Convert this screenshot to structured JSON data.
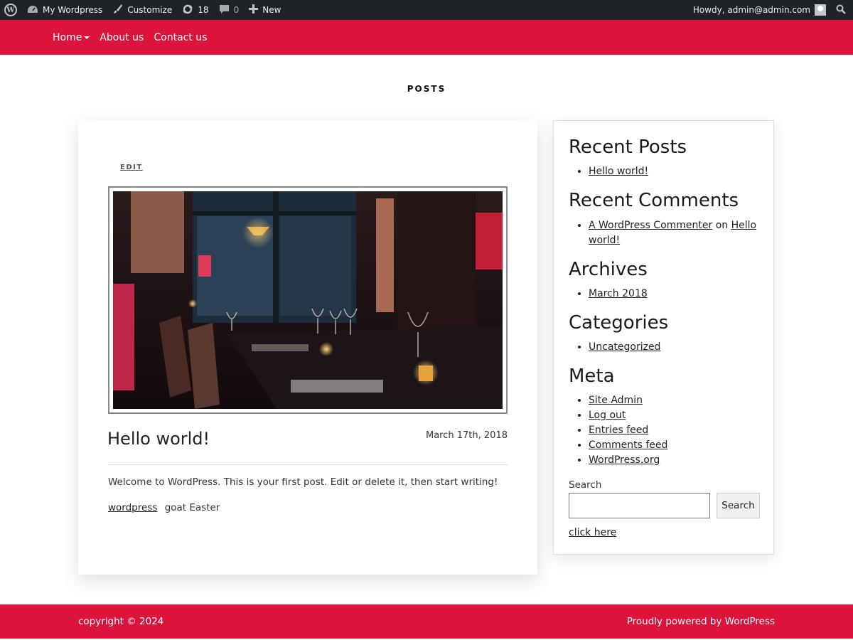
{
  "adminbar": {
    "site_name": "My Wordpress",
    "customize": "Customize",
    "updates_count": "18",
    "comments_count": "0",
    "new_label": "New",
    "howdy": "Howdy, admin@admin.com"
  },
  "nav": {
    "items": [
      {
        "label": "Home",
        "has_dropdown": true
      },
      {
        "label": "About us"
      },
      {
        "label": "Contact us"
      }
    ]
  },
  "page": {
    "heading": "POSTS"
  },
  "post": {
    "edit_label": "EDIT",
    "title": "Hello world!",
    "date": "March 17th, 2018",
    "excerpt": "Welcome to WordPress. This is your first post. Edit or delete it, then start writing!",
    "tag_link": "wordpress",
    "tags_rest": "goat Easter"
  },
  "sidebar": {
    "recent_posts": {
      "title": "Recent Posts",
      "items": [
        "Hello world!"
      ]
    },
    "recent_comments": {
      "title": "Recent Comments",
      "author": "A WordPress Commenter",
      "on": "on",
      "post": "Hello world!"
    },
    "archives": {
      "title": "Archives",
      "items": [
        "March 2018"
      ]
    },
    "categories": {
      "title": "Categories",
      "items": [
        "Uncategorized"
      ]
    },
    "meta": {
      "title": "Meta",
      "items": [
        "Site Admin",
        "Log out",
        "Entries feed",
        "Comments feed",
        "WordPress.org"
      ]
    },
    "search": {
      "label": "Search",
      "button": "Search",
      "value": ""
    },
    "click_here": "click here"
  },
  "footer": {
    "copyright": "copyright © 2024",
    "powered": "Proudly powered by WordPress"
  },
  "colors": {
    "brand_red": "#dc143c",
    "adminbar_bg": "#1d2327"
  }
}
